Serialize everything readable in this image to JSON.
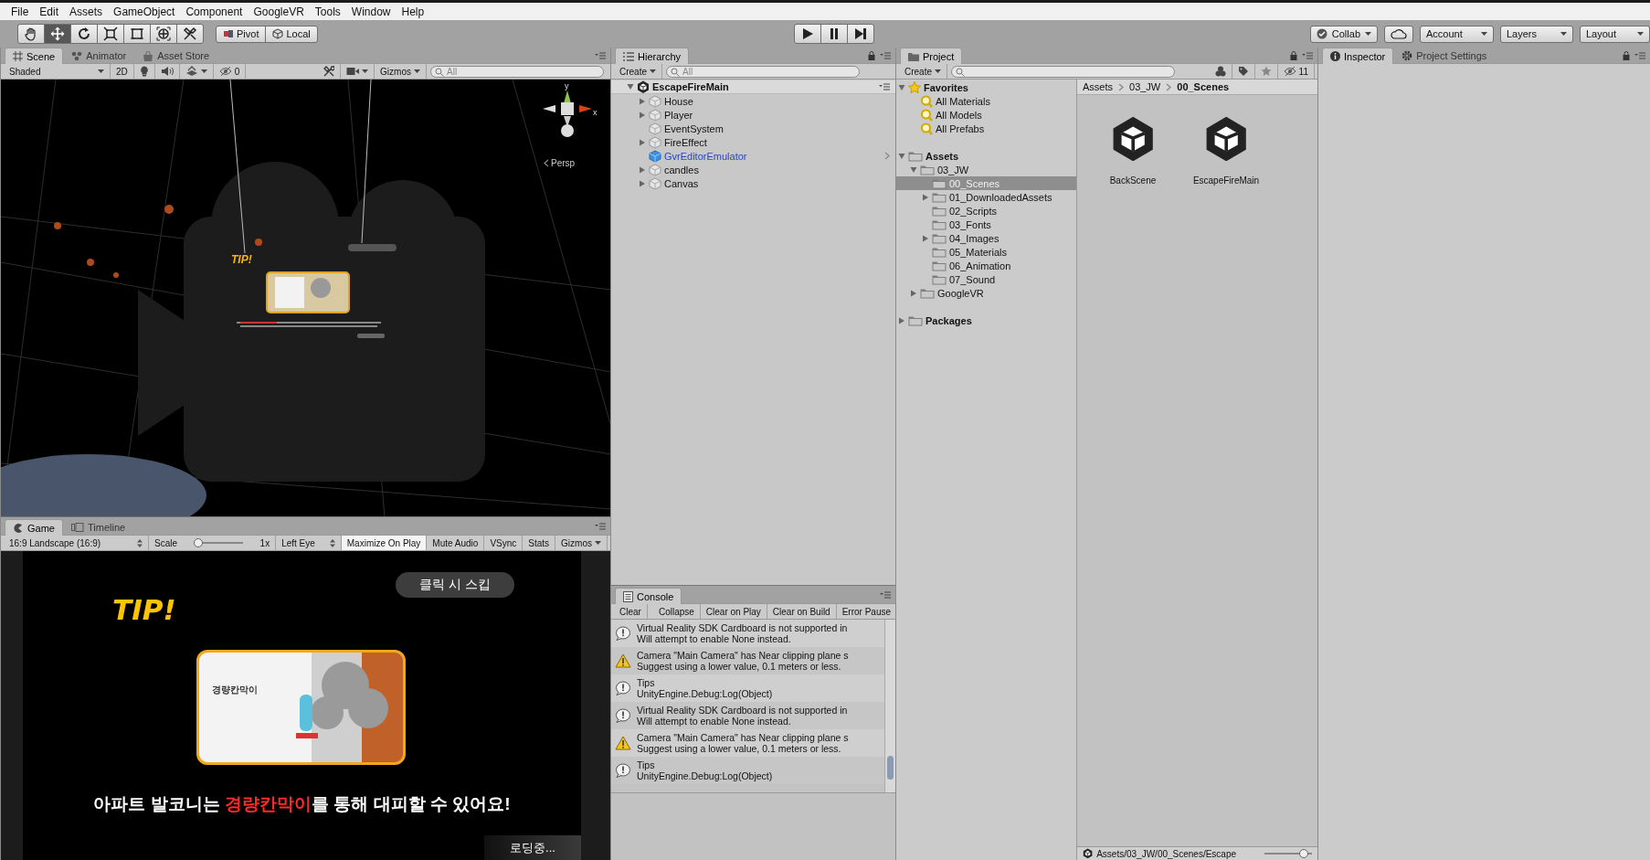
{
  "menu_bar": {
    "items": [
      "File",
      "Edit",
      "Assets",
      "GameObject",
      "Component",
      "GoogleVR",
      "Tools",
      "Window",
      "Help"
    ]
  },
  "toolbar": {
    "tools": [
      {
        "kind": "hand",
        "selected": false
      },
      {
        "kind": "move",
        "selected": true
      },
      {
        "kind": "rotate",
        "selected": false
      },
      {
        "kind": "scale",
        "selected": false
      },
      {
        "kind": "rect",
        "selected": false
      },
      {
        "kind": "transform",
        "selected": false
      },
      {
        "kind": "custom",
        "selected": false
      }
    ],
    "pivot": "Pivot",
    "local": "Local",
    "playback": [
      {
        "kind": "play",
        "selected": false
      },
      {
        "kind": "pause",
        "selected": false
      },
      {
        "kind": "step",
        "selected": false
      }
    ],
    "collab": "Collab",
    "account": "Account",
    "layers": "Layers",
    "layout": "Layout"
  },
  "scene_panel": {
    "tabs": [
      {
        "label": "Scene",
        "kind": "scene",
        "selected": true
      },
      {
        "label": "Animator",
        "kind": "animator",
        "selected": false
      },
      {
        "label": "Asset Store",
        "kind": "store",
        "selected": false
      }
    ],
    "shading": "Shaded",
    "view_toggles": [
      {
        "kind": "dimension",
        "label": "2D",
        "on": false
      },
      {
        "kind": "lighting",
        "on": false
      },
      {
        "kind": "audio",
        "on": false
      },
      {
        "kind": "effects",
        "on": false
      }
    ],
    "hidden_count": "0",
    "gizmos": "Gizmos",
    "search_placeholder": "All",
    "view": {
      "axis_y": "y",
      "axis_x": "x",
      "projection": "Persp",
      "tip": "TIP!"
    }
  },
  "game_panel": {
    "tabs": [
      {
        "label": "Game",
        "kind": "game",
        "selected": true
      },
      {
        "label": "Timeline",
        "kind": "timeline",
        "selected": false
      }
    ],
    "resolution": "16:9 Landscape (16:9)",
    "scale_label": "Scale",
    "scale_slider": {
      "level": 0
    },
    "scale_value": "1x",
    "eye": "Left Eye",
    "toggles": [
      {
        "label": "Maximize On Play",
        "on": true
      },
      {
        "label": "Mute Audio",
        "on": false
      },
      {
        "label": "VSync",
        "on": false
      },
      {
        "label": "Stats",
        "on": false
      }
    ],
    "gizmos": "Gizmos",
    "view": {
      "skip_button": "클릭 시 스킵",
      "tip": "TIP!",
      "illustration_label": "경량칸막이",
      "caption": [
        {
          "text": "아파트 발코니는 ",
          "highlight": false
        },
        {
          "text": "경량칸막이",
          "highlight": true
        },
        {
          "text": "를 통해 대피할 수 있어요!",
          "highlight": false
        }
      ],
      "loading": "로딩중..."
    }
  },
  "hierarchy": {
    "tab": "Hierarchy",
    "create": "Create",
    "search_placeholder": "All",
    "scene": {
      "label": "EscapeFireMain",
      "expandable": true,
      "expanded": true,
      "children": [
        {
          "label": "House",
          "kind": "object",
          "expandable": true,
          "expanded": false
        },
        {
          "label": "Player",
          "kind": "object",
          "expandable": true,
          "expanded": false
        },
        {
          "label": "EventSystem",
          "kind": "object",
          "expandable": false
        },
        {
          "label": "FireEffect",
          "kind": "object",
          "expandable": true,
          "expanded": false
        },
        {
          "label": "GvrEditorEmulator",
          "kind": "prefab",
          "expandable": false
        },
        {
          "label": "candles",
          "kind": "object",
          "expandable": true,
          "expanded": false
        },
        {
          "label": "Canvas",
          "kind": "object",
          "expandable": true,
          "expanded": false
        }
      ]
    }
  },
  "console": {
    "tab": "Console",
    "buttons": [
      "Clear",
      "Collapse",
      "Clear on Play",
      "Clear on Build",
      "Error Pause"
    ],
    "messages": [
      {
        "kind": "info",
        "lines": [
          "Virtual Reality SDK Cardboard is not supported in",
          "Will attempt to enable None instead."
        ]
      },
      {
        "kind": "warning",
        "lines": [
          "Camera \"Main Camera\" has Near clipping plane s",
          "Suggest using a lower value, 0.1 meters or less."
        ]
      },
      {
        "kind": "info",
        "lines": [
          "Tips",
          "UnityEngine.Debug:Log(Object)"
        ]
      },
      {
        "kind": "info",
        "lines": [
          "Virtual Reality SDK Cardboard is not supported in",
          "Will attempt to enable None instead."
        ]
      },
      {
        "kind": "warning",
        "lines": [
          "Camera \"Main Camera\" has Near clipping plane s",
          "Suggest using a lower value, 0.1 meters or less."
        ]
      },
      {
        "kind": "info",
        "lines": [
          "Tips",
          "UnityEngine.Debug:Log(Object)"
        ]
      }
    ]
  },
  "project": {
    "tab": "Project",
    "create": "Create",
    "hidden_count": "11",
    "tree": [
      {
        "label": "Favorites",
        "kind": "favorites",
        "expandable": true,
        "expanded": true,
        "selected": false,
        "children": [
          {
            "label": "All Materials",
            "kind": "search",
            "expandable": false,
            "selected": false
          },
          {
            "label": "All Models",
            "kind": "search",
            "expandable": false,
            "selected": false
          },
          {
            "label": "All Prefabs",
            "kind": "search",
            "expandable": false,
            "selected": false
          }
        ]
      },
      {
        "label": "Assets",
        "kind": "root",
        "expandable": true,
        "expanded": true,
        "selected": false,
        "children": [
          {
            "label": "03_JW",
            "kind": "folder",
            "expandable": true,
            "expanded": true,
            "selected": false,
            "children": [
              {
                "label": "00_Scenes",
                "kind": "folder",
                "expandable": false,
                "selected": true
              },
              {
                "label": "01_DownloadedAssets",
                "kind": "folder",
                "expandable": true,
                "expanded": false,
                "selected": false
              },
              {
                "label": "02_Scripts",
                "kind": "folder",
                "expandable": false,
                "selected": false
              },
              {
                "label": "03_Fonts",
                "kind": "folder",
                "expandable": false,
                "selected": false
              },
              {
                "label": "04_Images",
                "kind": "folder",
                "expandable": true,
                "expanded": false,
                "selected": false
              },
              {
                "label": "05_Materials",
                "kind": "folder",
                "expandable": false,
                "selected": false
              },
              {
                "label": "06_Animation",
                "kind": "folder",
                "expandable": false,
                "selected": false
              },
              {
                "label": "07_Sound",
                "kind": "folder",
                "expandable": false,
                "selected": false
              }
            ]
          },
          {
            "label": "GoogleVR",
            "kind": "folder",
            "expandable": true,
            "expanded": false,
            "selected": false
          }
        ]
      },
      {
        "label": "Packages",
        "kind": "root",
        "expandable": true,
        "expanded": false,
        "selected": false
      }
    ],
    "breadcrumb": [
      "Assets",
      "03_JW",
      "00_Scenes"
    ],
    "assets": [
      {
        "label": "BackScene"
      },
      {
        "label": "EscapeFireMain"
      }
    ],
    "footer_path": "Assets/03_JW/00_Scenes/Escape",
    "icon_size": {
      "level": 0.9
    }
  },
  "inspector": {
    "tabs": [
      {
        "label": "Inspector",
        "kind": "inspector",
        "selected": true
      },
      {
        "label": "Project Settings",
        "kind": "settings",
        "selected": false
      }
    ]
  }
}
